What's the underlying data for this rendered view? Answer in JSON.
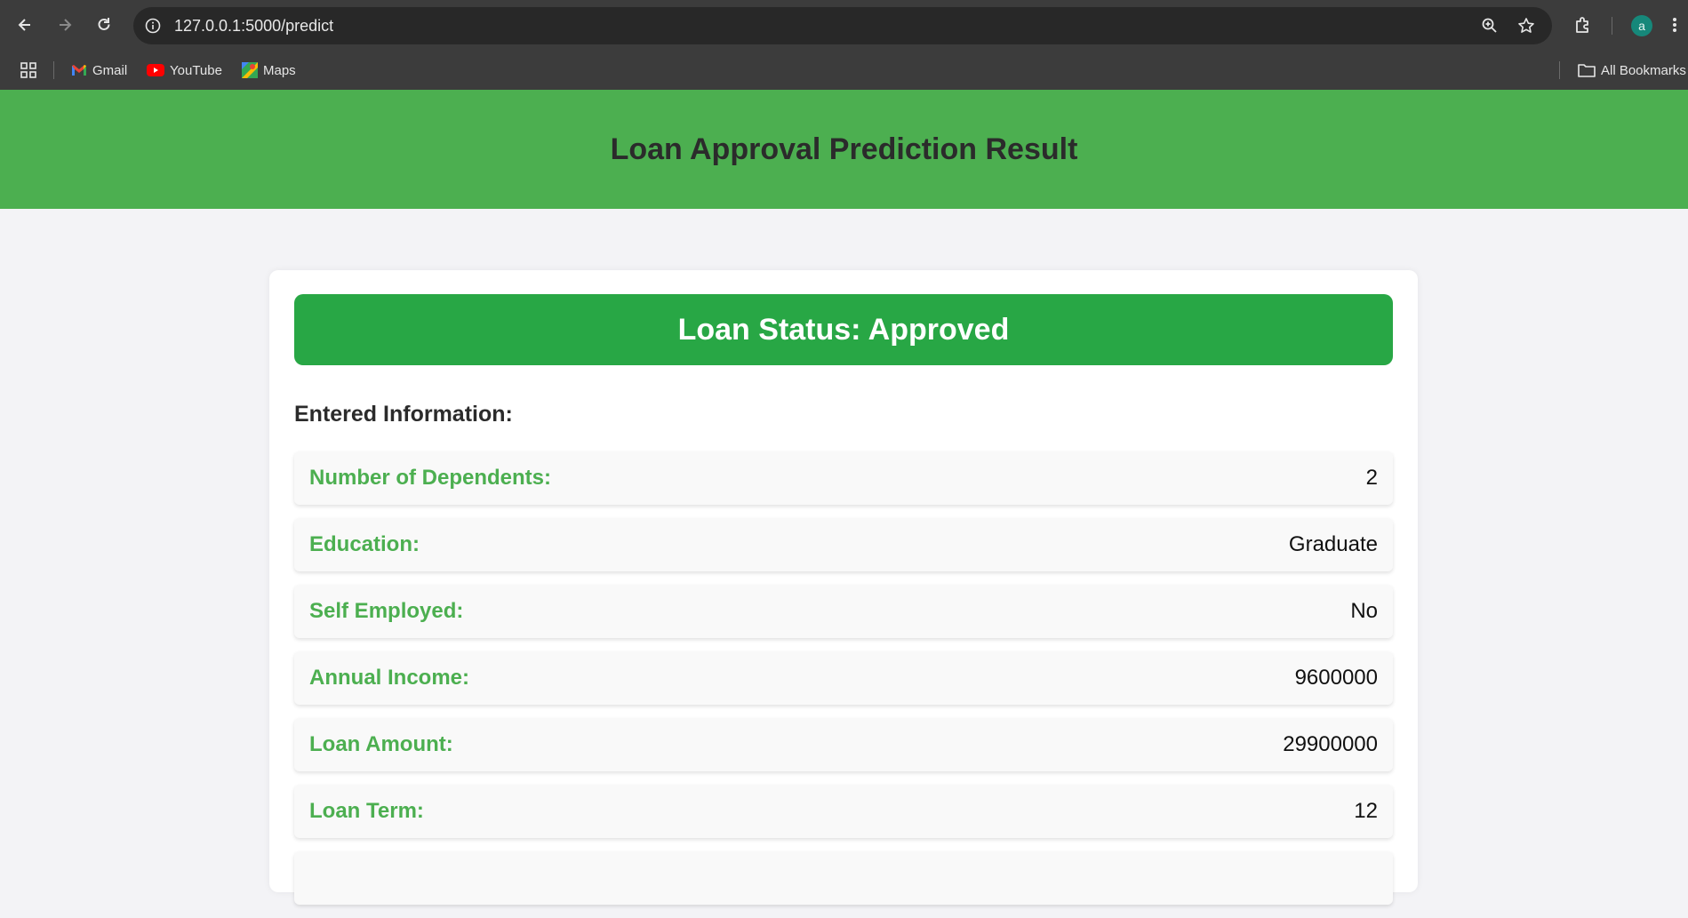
{
  "browser": {
    "url": "127.0.0.1:5000/predict",
    "profile_initial": "a",
    "bookmarks": [
      {
        "label": "Gmail"
      },
      {
        "label": "YouTube"
      },
      {
        "label": "Maps"
      }
    ],
    "all_bookmarks_label": "All Bookmarks"
  },
  "page": {
    "header_title": "Loan Approval Prediction Result",
    "status_text": "Loan Status: Approved",
    "section_title": "Entered Information:",
    "fields": [
      {
        "label": "Number of Dependents:",
        "value": "2"
      },
      {
        "label": "Education:",
        "value": "Graduate"
      },
      {
        "label": "Self Employed:",
        "value": "No"
      },
      {
        "label": "Annual Income:",
        "value": "9600000"
      },
      {
        "label": "Loan Amount:",
        "value": "29900000"
      },
      {
        "label": "Loan Term:",
        "value": "12"
      },
      {
        "label": "",
        "value": ""
      }
    ]
  },
  "colors": {
    "header_green": "#4caf50",
    "approved_green": "#28a745",
    "label_green": "#4caf50",
    "page_background": "#f3f3f6"
  },
  "icons": [
    "back-icon",
    "forward-icon",
    "reload-icon",
    "site-info-icon",
    "zoom-icon",
    "star-icon",
    "extensions-icon",
    "menu-icon",
    "apps-icon",
    "gmail-icon",
    "youtube-icon",
    "maps-icon",
    "folder-icon"
  ]
}
